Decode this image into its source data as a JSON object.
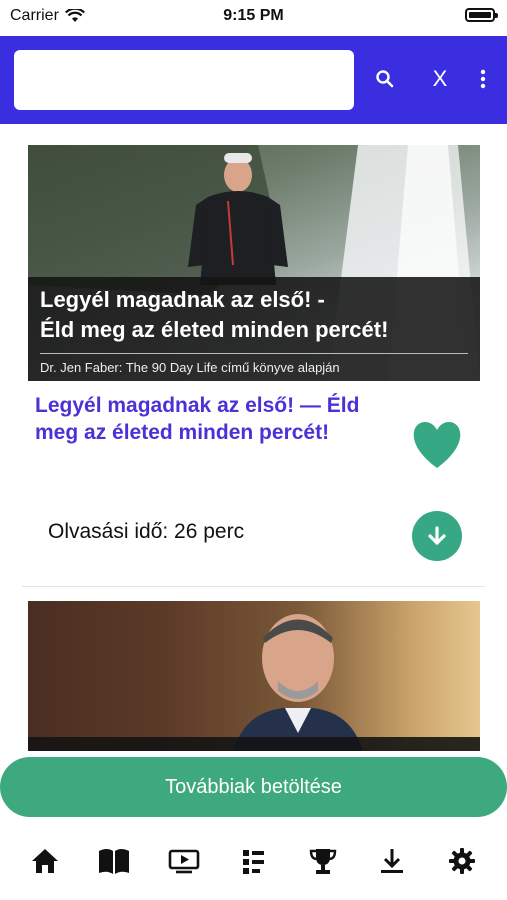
{
  "status_bar": {
    "carrier": "Carrier",
    "time": "9:15 PM"
  },
  "header": {
    "search_placeholder": "",
    "search_value": "",
    "close_label": "X",
    "accent_color": "#3a2ee0"
  },
  "article": {
    "hero_title_line1": "Legyél magadnak az első! -",
    "hero_title_line2": "Éld meg az életed minden percét!",
    "hero_subtitle": "Dr. Jen Faber: The 90 Day Life című könyve alapján",
    "title": "Legyél magadnak az első! —  Éld meg az életed minden percét!",
    "read_time": "Olvasási idő: 26 perc",
    "favorite_color": "#36a883"
  },
  "load_more": {
    "label": "Továbbiak betöltése"
  },
  "bottom_nav": {
    "items": [
      {
        "icon": "home-icon"
      },
      {
        "icon": "book-icon"
      },
      {
        "icon": "video-icon"
      },
      {
        "icon": "playlist-icon"
      },
      {
        "icon": "trophy-icon"
      },
      {
        "icon": "download-icon"
      },
      {
        "icon": "gear-icon"
      }
    ]
  }
}
